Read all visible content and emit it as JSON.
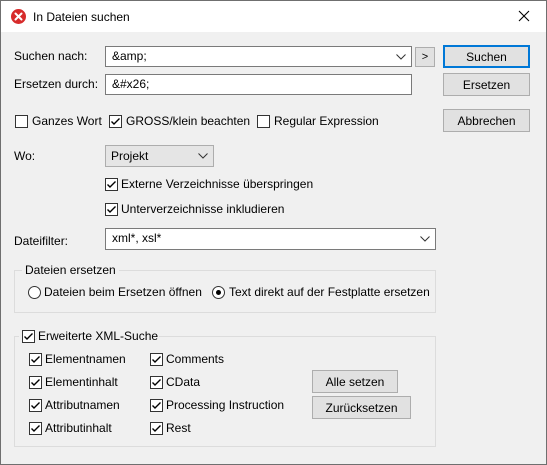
{
  "window": {
    "title": "In Dateien suchen",
    "close_label": "✕"
  },
  "search": {
    "label": "Suchen nach:",
    "value": "&amp;",
    "history_label": ">"
  },
  "replace": {
    "label": "Ersetzen durch:",
    "value": "&#x26;"
  },
  "buttons": {
    "search": "Suchen",
    "replace": "Ersetzen",
    "cancel": "Abbrechen"
  },
  "options": {
    "whole_word": "Ganzes Wort",
    "match_case": "GROSS/klein beachten",
    "regex": "Regular Expression"
  },
  "where": {
    "label": "Wo:",
    "selected": "Projekt",
    "skip_external": "Externe Verzeichnisse überspringen",
    "include_subfolders": "Unterverzeichnisse inkludieren"
  },
  "filter": {
    "label": "Dateifilter:",
    "value": "xml*, xsl*"
  },
  "replace_files": {
    "title": "Dateien ersetzen",
    "open_on_replace": "Dateien beim Ersetzen öffnen",
    "direct_on_disk": "Text direkt auf der Festplatte ersetzen"
  },
  "xml_search": {
    "title": "Erweiterte XML-Suche",
    "element_names": "Elementnamen",
    "element_content": "Elementinhalt",
    "attribute_names": "Attributnamen",
    "attribute_content": "Attributinhalt",
    "comments": "Comments",
    "cdata": "CData",
    "processing_instruction": "Processing Instruction",
    "rest": "Rest",
    "set_all": "Alle setzen",
    "reset": "Zurücksetzen"
  }
}
